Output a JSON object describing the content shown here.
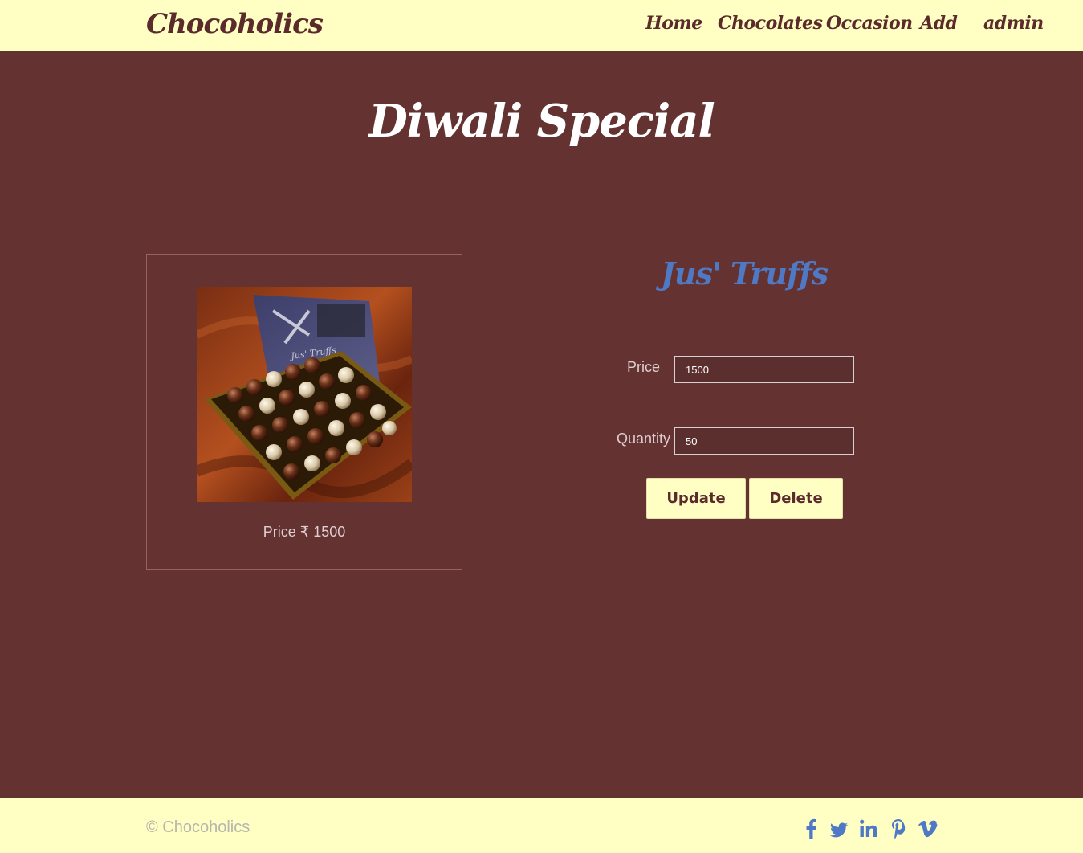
{
  "navbar": {
    "brand": "Chocoholics",
    "links": [
      "Home",
      "Chocolates",
      "Occasion",
      "Add",
      "admin"
    ]
  },
  "page": {
    "title": "Diwali Special"
  },
  "product_card": {
    "price_label": "Price ₹ 1500",
    "image_label": "Jus' Truffs"
  },
  "details": {
    "name": "Jus' Truffs",
    "price_label": "Price",
    "price_value": "1500",
    "quantity_label": "Quantity",
    "quantity_value": "50",
    "update_label": "Update",
    "delete_label": "Delete"
  },
  "footer": {
    "copyright": "© Chocoholics",
    "social_icons": [
      "facebook-icon",
      "twitter-icon",
      "linkedin-icon",
      "pinterest-icon",
      "vimeo-icon"
    ]
  },
  "colors": {
    "background": "#653232",
    "navbar": "#ffffc4",
    "brand_text": "#5b2a2a",
    "product_name": "#4f79c4",
    "social_icons": "#4f79c4"
  }
}
